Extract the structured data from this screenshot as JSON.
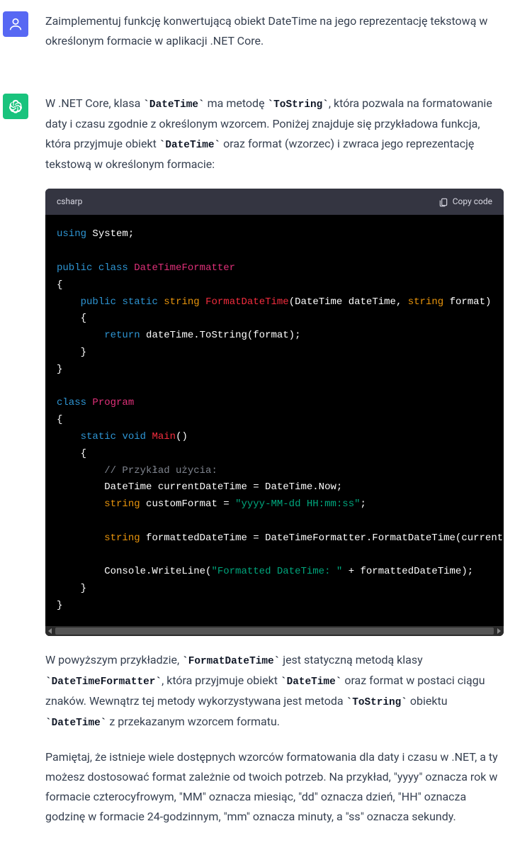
{
  "user_message": {
    "text": "Zaimplementuj funkcję konwertującą obiekt DateTime na jego reprezentację tekstową w określonym formacie w aplikacji .NET Core."
  },
  "assistant_message": {
    "intro": {
      "seg1": "W .NET Core, klasa ",
      "code1": "`DateTime`",
      "seg2": " ma metodę ",
      "code2": "`ToString`",
      "seg3": ", która pozwala na formatowanie daty i czasu zgodnie z określonym wzorcem. Poniżej znajduje się przykładowa funkcja, która przyjmuje obiekt ",
      "code3": "`DateTime`",
      "seg4": " oraz format (wzorzec) i zwraca jego reprezentację tekstową w określonym formacie:"
    },
    "code_block": {
      "language": "csharp",
      "copy_label": "Copy code",
      "tokens": {
        "using": "using",
        "system": " System;",
        "public1": "public",
        "class1": "class",
        "dtf": "DateTimeFormatter",
        "public2": "public",
        "static1": "static",
        "string1": "string",
        "fdt": "FormatDateTime",
        "sig1": "(DateTime dateTime, ",
        "string2": "string",
        "sig2": " format)",
        "return": "return",
        "retexpr": " dateTime.ToString(format);",
        "class2": "class",
        "program": "Program",
        "static2": "static",
        "void": "void",
        "main": "Main",
        "unit": "()",
        "comment": "// Przykład użycia:",
        "dtline": "DateTime currentDateTime = DateTime.Now;",
        "string3": "string",
        "cfassign": " customFormat = ",
        "fmtstr": "\"yyyy-MM-dd HH:mm:ss\"",
        "string4": "string",
        "fdassign": " formattedDateTime = DateTimeFormatter.FormatDateTime(currentDateTime, customFormat);",
        "cw1": "Console.WriteLine(",
        "outstr": "\"Formatted DateTime: \"",
        "cw2": " + formattedDateTime);"
      }
    },
    "explain": {
      "seg1": "W powyższym przykładzie, ",
      "code1": "`FormatDateTime`",
      "seg2": " jest statyczną metodą klasy ",
      "code2": "`DateTimeFormatter`",
      "seg3": ", która przyjmuje obiekt ",
      "code3": "`DateTime`",
      "seg4": " oraz format w postaci ciągu znaków. Wewnątrz tej metody wykorzystywana jest metoda ",
      "code4": "`ToString`",
      "seg5": " obiektu ",
      "code5": "`DateTime`",
      "seg6": " z przekazanym wzorcem formatu."
    },
    "note": "Pamiętaj, że istnieje wiele dostępnych wzorców formatowania dla daty i czasu w .NET, a ty możesz dostosować format zależnie od twoich potrzeb. Na przykład, \"yyyy\" oznacza rok w formacie czterocyfrowym, \"MM\" oznacza miesiąc, \"dd\" oznacza dzień, \"HH\" oznacza godzinę w formacie 24-godzinnym, \"mm\" oznacza minuty, a \"ss\" oznacza sekundy."
  }
}
